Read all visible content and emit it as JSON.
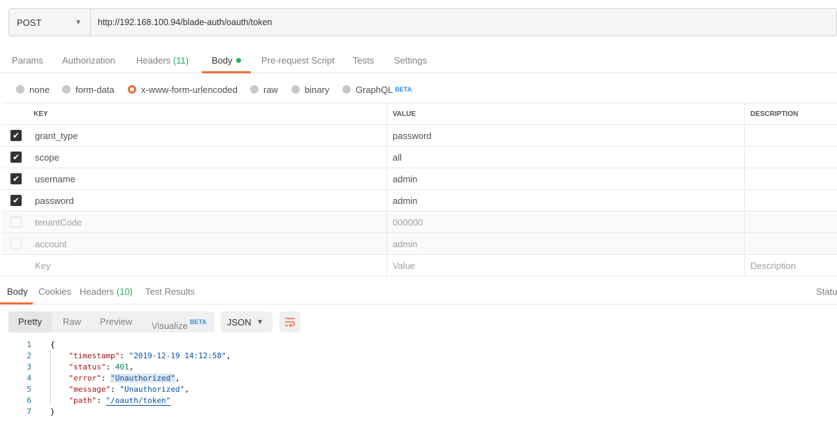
{
  "request": {
    "method": "POST",
    "url": "http://192.168.100.94/blade-auth/oauth/token"
  },
  "request_tabs": {
    "params": "Params",
    "authorization": "Authorization",
    "headers": "Headers",
    "headers_count": "(11)",
    "body": "Body",
    "prerequest": "Pre-request Script",
    "tests": "Tests",
    "settings": "Settings"
  },
  "body_types": {
    "none": "none",
    "form_data": "form-data",
    "urlencoded": "x-www-form-urlencoded",
    "raw": "raw",
    "binary": "binary",
    "graphql": "GraphQL",
    "beta": "BETA",
    "selected": "x-www-form-urlencoded"
  },
  "params_table": {
    "headers": {
      "key": "KEY",
      "value": "VALUE",
      "description": "DESCRIPTION"
    },
    "rows": [
      {
        "checked": true,
        "key": "grant_type",
        "value": "password"
      },
      {
        "checked": true,
        "key": "scope",
        "value": "all"
      },
      {
        "checked": true,
        "key": "username",
        "value": "admin"
      },
      {
        "checked": true,
        "key": "password",
        "value": "admin"
      },
      {
        "checked": false,
        "key": "tenantCode",
        "value": "000000"
      },
      {
        "checked": false,
        "key": "account",
        "value": "admin"
      }
    ],
    "placeholder": {
      "key": "Key",
      "value": "Value",
      "description": "Description"
    }
  },
  "response_tabs": {
    "body": "Body",
    "cookies": "Cookies",
    "headers": "Headers",
    "headers_count": "(10)",
    "test_results": "Test Results",
    "status": "Status"
  },
  "response_view": {
    "pretty": "Pretty",
    "raw": "Raw",
    "preview": "Preview",
    "visualize": "Visualize",
    "beta": "BETA",
    "format": "JSON"
  },
  "response_code": {
    "line_numbers": [
      "1",
      "2",
      "3",
      "4",
      "5",
      "6",
      "7"
    ],
    "open_brace": "{",
    "close_brace": "}",
    "fields": [
      {
        "key": "\"timestamp\"",
        "value": "\"2019-12-19 14:12:58\""
      },
      {
        "key": "\"status\"",
        "value": "401"
      },
      {
        "key": "\"error\"",
        "value": "\"Unauthorized\""
      },
      {
        "key": "\"message\"",
        "value": "\"Unauthorized\""
      },
      {
        "key": "\"path\"",
        "value": "\"/oauth/token\""
      }
    ]
  },
  "colors": {
    "accent": "#f26b3a",
    "count_green": "#27ae60",
    "beta_blue": "#2d8ceb"
  },
  "icons": {
    "method_dropdown": "chevron-down-icon",
    "wrap": "wrap-lines-icon",
    "checkbox": "checkmark-icon"
  }
}
